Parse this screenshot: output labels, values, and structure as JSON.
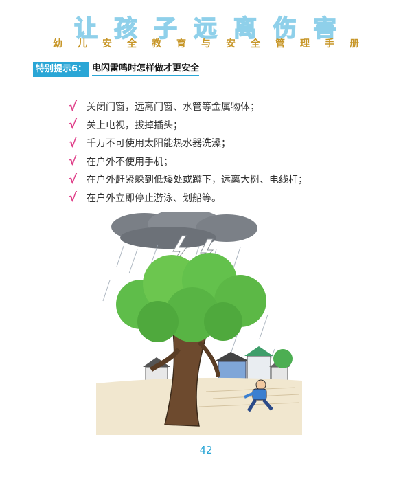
{
  "header": {
    "title_chars": [
      "让",
      "孩",
      "子",
      "远",
      "离",
      "伤",
      "害"
    ],
    "subtitle": "幼儿安全教育与安全管理手册"
  },
  "tip": {
    "tag": "特别提示6：",
    "heading": "电闪雷鸣时怎样做才更安全"
  },
  "items": [
    "关闭门窗，远离门窗、水管等金属物体；",
    "关上电视，拔掉插头；",
    "千万不可使用太阳能热水器洗澡；",
    "在户外不使用手机；",
    "在户外赶紧躲到低矮处或蹲下，远离大树、电线杆；",
    "在户外立即停止游泳、划船等。"
  ],
  "check_mark": "√",
  "page_number": "42",
  "colors": {
    "accent": "#2aa6d6",
    "check": "#e0408a",
    "subtitle": "#c79628",
    "title_outline": "#8fd0ea"
  }
}
